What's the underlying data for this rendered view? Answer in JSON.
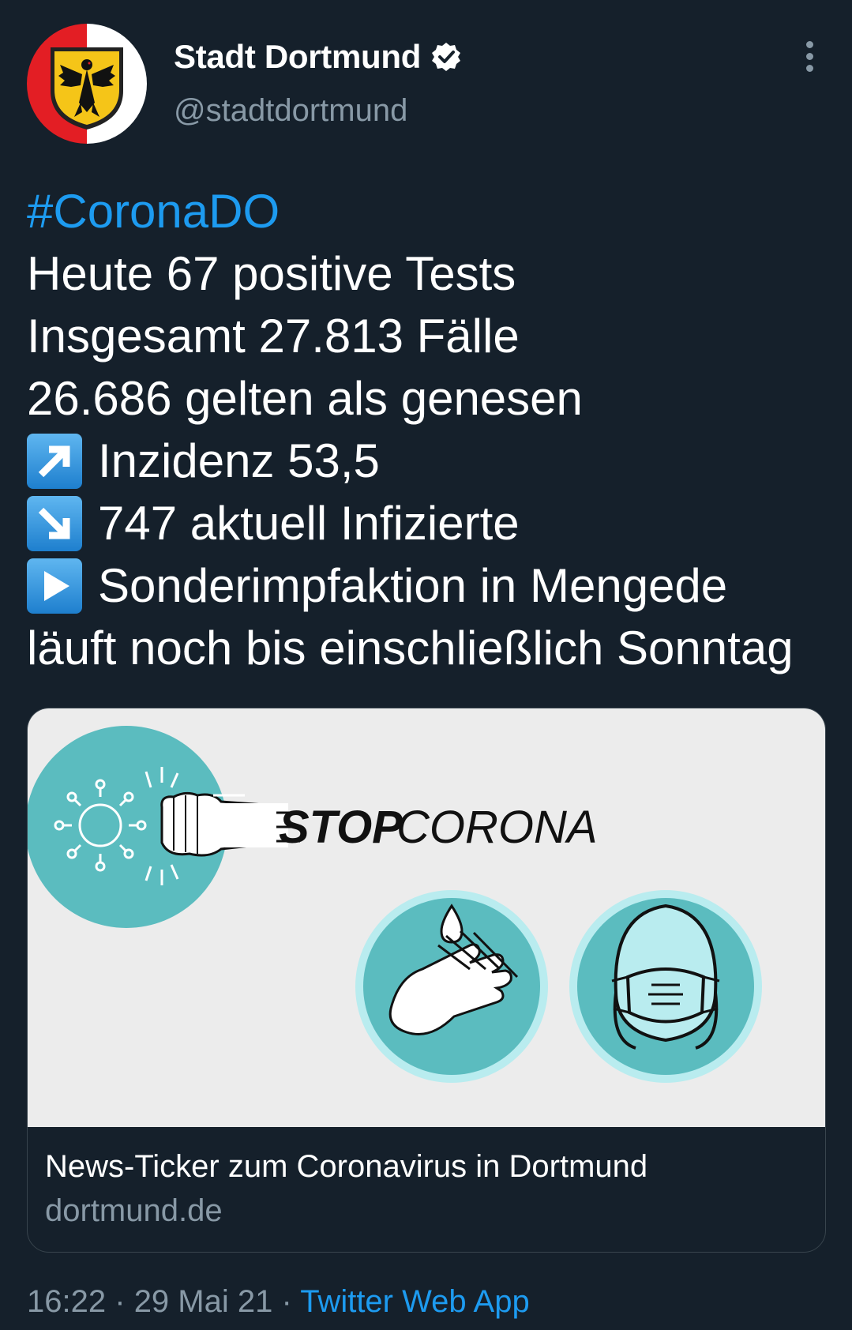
{
  "author": {
    "name": "Stadt Dortmund",
    "handle": "@stadtdortmund",
    "avatar": "dortmund-coat-of-arms",
    "verified": true
  },
  "tweet": {
    "hashtag": "#CoronaDO",
    "lines": [
      "Heute 67 positive Tests",
      "Insgesamt 27.813 Fälle",
      "26.686 gelten als genesen"
    ],
    "emoji_lines": [
      {
        "icon": "arrow-up-right-emoji",
        "text": "Inzidenz 53,5"
      },
      {
        "icon": "arrow-down-right-emoji",
        "text": "747 aktuell Infizierte"
      },
      {
        "icon": "play-button-emoji",
        "text": "Sonderimpfaktion in Mengede"
      }
    ],
    "last_line": "läuft noch bis einschließlich Sonntag"
  },
  "card": {
    "image_text_bold": "STOP",
    "image_text": "CORONA",
    "title": "News-Ticker zum Coronavirus in Dortmund",
    "domain": "dortmund.de"
  },
  "meta": {
    "time": "16:22",
    "date": "29 Mai 21",
    "separator": "·",
    "source": "Twitter Web App"
  },
  "colors": {
    "background": "#15202b",
    "link": "#1d9bf0",
    "secondary_text": "#8899a6",
    "card_bg": "#ececec",
    "teal": "#5bbcbf"
  }
}
